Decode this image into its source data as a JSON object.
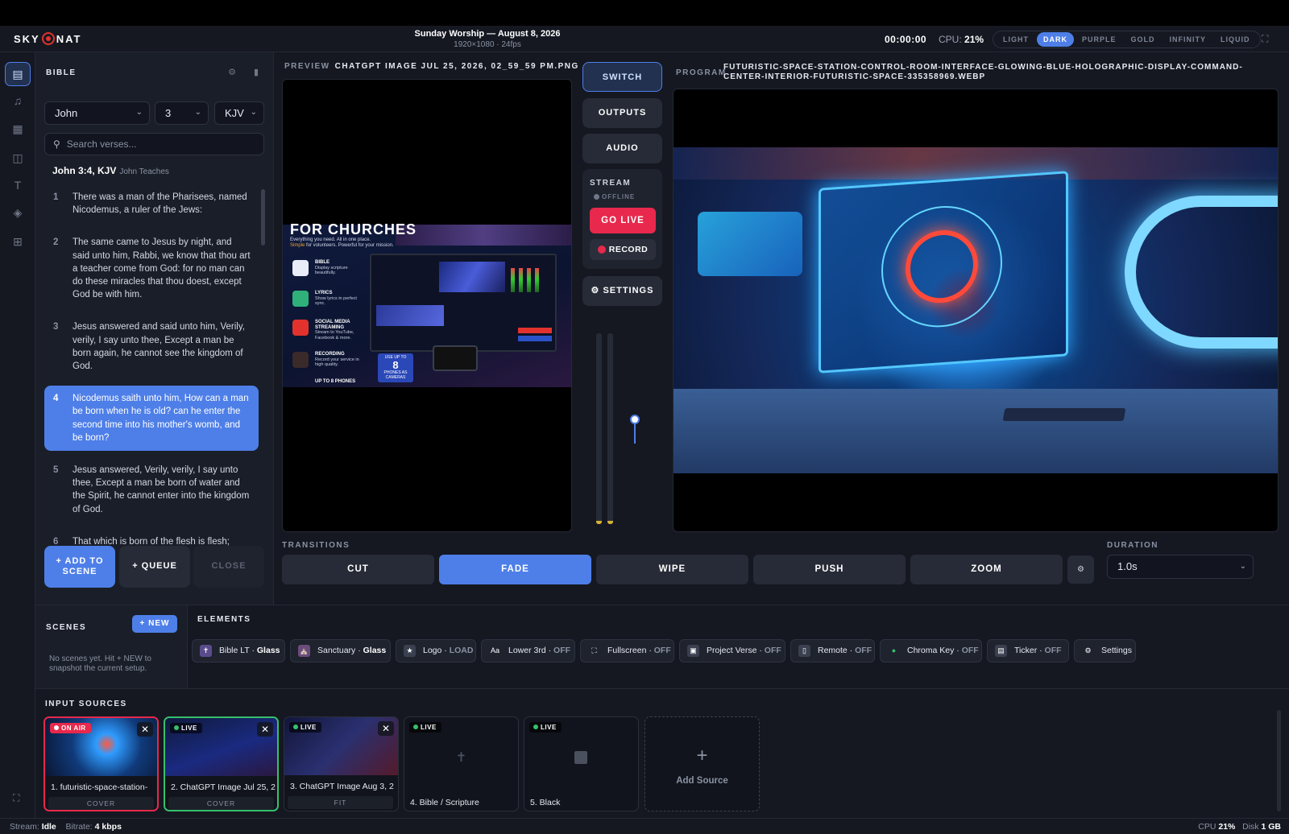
{
  "header": {
    "brand": "SKY",
    "brand2": "NAT",
    "title": "Sunday Worship — August 8, 2026",
    "subtitle": "1920×1080 · 24fps",
    "timer": "00:00:00",
    "cpu_label": "CPU:",
    "cpu_value": "21%",
    "themes": [
      "LIGHT",
      "DARK",
      "PURPLE",
      "GOLD",
      "INFINITY",
      "LIQUID"
    ],
    "active_theme": "DARK",
    "fullscreen_icon": "expand-icon"
  },
  "rail": {
    "items": [
      {
        "name": "bible",
        "icon": "book-icon",
        "glyph": "▤"
      },
      {
        "name": "lyrics",
        "icon": "music-icon",
        "glyph": "♫"
      },
      {
        "name": "media",
        "icon": "film-icon",
        "glyph": "▦"
      },
      {
        "name": "slides",
        "icon": "slides-icon",
        "glyph": "◫"
      },
      {
        "name": "text",
        "icon": "text-icon",
        "glyph": "T"
      },
      {
        "name": "layers",
        "icon": "layers-icon",
        "glyph": "◈"
      },
      {
        "name": "grid",
        "icon": "grid-icon",
        "glyph": "⊞"
      }
    ]
  },
  "bible": {
    "title": "BIBLE",
    "book": "John",
    "chapter": "3",
    "version": "KJV",
    "search_placeholder": "Search verses...",
    "reference": "John 3:4, KJV",
    "reference_sub": "John Teaches",
    "verses": [
      {
        "num": "1",
        "text": "There was a man of the Pharisees, named Nicodemus, a ruler of the Jews:"
      },
      {
        "num": "2",
        "text": "The same came to Jesus by night, and said unto him, Rabbi, we know that thou art a teacher come from God: for no man can do these miracles that thou doest, except God be with him."
      },
      {
        "num": "3",
        "text": "Jesus answered and said unto him, Verily, verily, I say unto thee, Except a man be born again, he cannot see the kingdom of God."
      },
      {
        "num": "4",
        "text": "Nicodemus saith unto him, How can a man be born when he is old? can he enter the second time into his mother's womb, and be born?"
      },
      {
        "num": "5",
        "text": "Jesus answered, Verily, verily, I say unto thee, Except a man be born of water and the Spirit, he cannot enter into the kingdom of God."
      },
      {
        "num": "6",
        "text": "That which is born of the flesh is flesh;"
      }
    ],
    "active_verse": "4",
    "add_to_scene": "+ ADD TO SCENE",
    "queue": "+ QUEUE",
    "close": "CLOSE"
  },
  "preview": {
    "label": "PREVIEW",
    "filename": "CHATGPT IMAGE JUL 25, 2026, 02_59_59 PM.PNG",
    "headline": "FOR CHURCHES",
    "tagline": "Everything you need. All in one place.",
    "tagline_accent": "Simple",
    "tagline_rest": "for volunteers. Powerful for your mission.",
    "features": [
      {
        "title": "BIBLE",
        "desc": "Display scripture beautifully."
      },
      {
        "title": "LYRICS",
        "desc": "Show lyrics in perfect sync."
      },
      {
        "title": "SOCIAL MEDIA STREAMING",
        "desc": "Stream to YouTube, Facebook & more."
      },
      {
        "title": "RECORDING",
        "desc": "Record your service in high quality."
      },
      {
        "title": "UP TO 8 PHONES",
        "desc": ""
      }
    ],
    "phones_top": "USE UP TO",
    "phones_num": "8",
    "phones_bottom": "PHONES AS CAMERAS"
  },
  "controls": {
    "switch": "SWITCH",
    "outputs": "OUTPUTS",
    "audio": "AUDIO",
    "stream_label": "STREAM",
    "stream_status": "OFFLINE",
    "go_live": "GO LIVE",
    "record": "RECORD",
    "settings": "⚙ SETTINGS",
    "fader_level": 0.55
  },
  "program": {
    "label": "PROGRAM",
    "filename": "FUTURISTIC-SPACE-STATION-CONTROL-ROOM-INTERFACE-GLOWING-BLUE-HOLOGRAPHIC-DISPLAY-COMMAND-CENTER-INTERIOR-FUTURISTIC-SPACE-335358969.WEBP"
  },
  "transitions": {
    "label": "TRANSITIONS",
    "items": [
      "CUT",
      "FADE",
      "WIPE",
      "PUSH",
      "ZOOM"
    ],
    "active": "FADE",
    "duration_label": "DURATION",
    "duration_value": "1.0s"
  },
  "scenes": {
    "title": "SCENES",
    "new": "+ NEW",
    "empty": "No scenes yet. Hit + NEW to snapshot the current setup."
  },
  "elements": {
    "title": "ELEMENTS",
    "chips": [
      {
        "label": "Bible LT · ",
        "state": "Glass",
        "icon": "bible-icon",
        "glyph": "✝",
        "color": "#5a4c8c"
      },
      {
        "label": "Sanctuary · ",
        "state": "Glass",
        "icon": "church-icon",
        "glyph": "⛪",
        "color": "#6a4c7c"
      },
      {
        "label": "Logo · ",
        "state": "LOAD",
        "icon": "star-icon",
        "glyph": "★",
        "color": "#3a4050"
      },
      {
        "label": "Lower 3rd · ",
        "state": "OFF",
        "icon": "font-icon",
        "glyph": "Aa",
        "color": "#1f232e"
      },
      {
        "label": "Fullscreen · ",
        "state": "OFF",
        "icon": "fullscreen-icon",
        "glyph": "⛶",
        "color": "#1f232e"
      },
      {
        "label": "Project Verse · ",
        "state": "OFF",
        "icon": "projector-icon",
        "glyph": "▣",
        "color": "#3a4050"
      },
      {
        "label": "Remote · ",
        "state": "OFF",
        "icon": "remote-icon",
        "glyph": "▯",
        "color": "#3a4050"
      },
      {
        "label": "Chroma Key · ",
        "state": "OFF",
        "icon": "chroma-key-icon",
        "glyph": "●",
        "color": "#1f232e"
      },
      {
        "label": "Ticker · ",
        "state": "OFF",
        "icon": "ticker-icon",
        "glyph": "▤",
        "color": "#3a4050"
      },
      {
        "label": "Settings",
        "state": "",
        "icon": "gear-icon",
        "glyph": "⚙",
        "color": "#1f232e"
      }
    ]
  },
  "inputs": {
    "title": "INPUT SOURCES",
    "sources": [
      {
        "badge": "ON AIR",
        "name": "1.  futuristic-space-station-",
        "fit": "COVER"
      },
      {
        "badge": "LIVE",
        "name": "2.  ChatGPT Image Jul 25, 2",
        "fit": "COVER"
      },
      {
        "badge": "LIVE",
        "name": "3.  ChatGPT Image Aug 3, 2",
        "fit": "FIT"
      },
      {
        "badge": "LIVE",
        "name": "4.  Bible / Scripture",
        "fit": ""
      },
      {
        "badge": "LIVE",
        "name": "5.  Black",
        "fit": ""
      }
    ],
    "add_source": "Add Source"
  },
  "status": {
    "stream_label": "Stream:",
    "stream_value": "Idle",
    "bitrate_label": "Bitrate:",
    "bitrate_value": "4 kbps",
    "cpu_label": "CPU",
    "cpu_value": "21%",
    "disk_label": "Disk",
    "disk_value": "1 GB"
  },
  "colors": {
    "accent": "#4e7fe8",
    "live_red": "#e8284c",
    "live_green": "#37c06b",
    "panel": "#1a1e28",
    "bg": "#151821"
  }
}
